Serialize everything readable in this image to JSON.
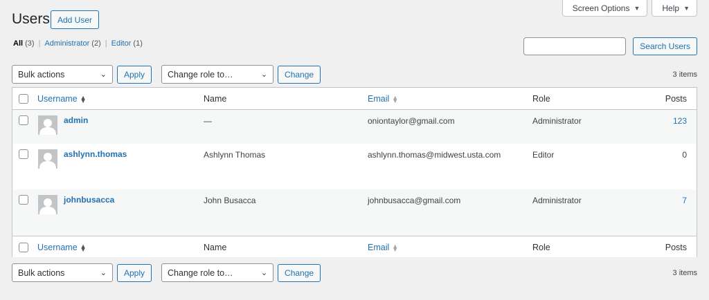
{
  "screen_meta": {
    "screen_options_label": "Screen Options",
    "help_label": "Help"
  },
  "header": {
    "title": "Users",
    "add_user_label": "Add User"
  },
  "filters": {
    "all": {
      "label": "All",
      "count": "(3)"
    },
    "administrator": {
      "label": "Administrator",
      "count": "(2)"
    },
    "editor": {
      "label": "Editor",
      "count": "(1)"
    },
    "separator": "|"
  },
  "search": {
    "value": "",
    "placeholder": "",
    "button_label": "Search Users"
  },
  "tablenav": {
    "bulk_actions_label": "Bulk actions",
    "apply_label": "Apply",
    "change_role_label": "Change role to…",
    "change_label": "Change",
    "items_count": "3 items"
  },
  "columns": {
    "username": "Username",
    "name": "Name",
    "email": "Email",
    "role": "Role",
    "posts": "Posts"
  },
  "rows": [
    {
      "username": "admin",
      "name": "—",
      "email": "oniontaylor@gmail.com",
      "role": "Administrator",
      "posts": "123"
    },
    {
      "username": "ashlynn.thomas",
      "name": "Ashlynn Thomas",
      "email": "ashlynn.thomas@midwest.usta.com",
      "role": "Editor",
      "posts": "0"
    },
    {
      "username": "johnbusacca",
      "name": "John Busacca",
      "email": "johnbusacca@gmail.com",
      "role": "Administrator",
      "posts": "7"
    }
  ],
  "colors": {
    "link": "#2271b1",
    "background": "#f0f0f1",
    "border": "#c3c4c7",
    "row_alt": "#f6f7f7"
  },
  "icons": {
    "avatar": "default-avatar-icon",
    "sort": "sort-arrows-icon",
    "dropdown": "chevron-down-icon",
    "caret": "caret-down-icon"
  }
}
